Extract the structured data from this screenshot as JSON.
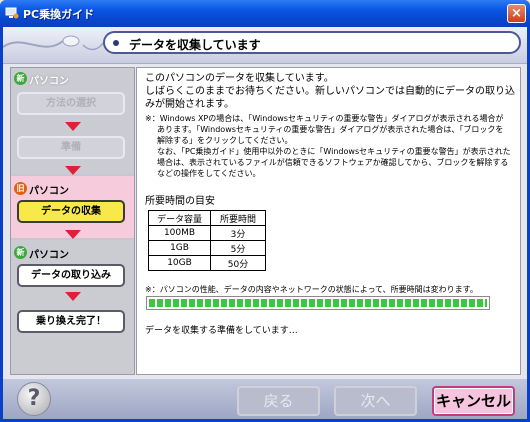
{
  "window": {
    "title": "PC乗換ガイド",
    "close_label": "×"
  },
  "header": {
    "title": "データを収集しています"
  },
  "sidebar": {
    "section_old_pc_1": {
      "badge": "新",
      "label": "パソコン"
    },
    "steps_top": [
      {
        "label": "方法の選択"
      },
      {
        "label": "準備"
      }
    ],
    "section_old_pc": {
      "badge": "旧",
      "label": "パソコン"
    },
    "step_active": {
      "label": "データの収集"
    },
    "section_new_pc": {
      "badge": "新",
      "label": "パソコン"
    },
    "steps_bottom": [
      {
        "label": "データの取り込み"
      },
      {
        "label": "乗り換え完了！"
      }
    ]
  },
  "main": {
    "intro_line1": "このパソコンのデータを収集しています。",
    "intro_line2": "しばらくこのままでお待ちください。新しいパソコンでは自動的にデータの取り込みが開始されます。",
    "note_line1": "※：Windows XPの場合は、「Windowsセキュリティの重要な警告」ダイアログが表示される場合が",
    "note_line2": "あります。「Windowsセキュリティの重要な警告」ダイアログが表示された場合は、「ブロックを",
    "note_line3": "解除する」をクリックしてください。",
    "note_line4": "なお、「PC乗換ガイド」使用中以外のときに「Windowsセキュリティの重要な警告」が表示された",
    "note_line5": "場合は、表示されているファイルが信頼できるソフトウェアか確認してから、ブロックを解除する",
    "note_line6": "などの操作をしてください。",
    "table_title": "所要時間の目安",
    "table": {
      "headers": [
        "データ容量",
        "所要時間"
      ],
      "rows": [
        [
          "100MB",
          "3分"
        ],
        [
          "1GB",
          "5分"
        ],
        [
          "10GB",
          "50分"
        ]
      ]
    },
    "caveat": "※：パソコンの性能、データの内容やネットワークの状態によって、所要時間は変わります。",
    "progress": {
      "fraction": 1.0
    },
    "status": "データを収集する準備をしています…"
  },
  "footer": {
    "help_label": "?",
    "back_label": "戻る",
    "next_label": "次へ",
    "cancel_label": "キャンセル"
  },
  "colors": {
    "titlebar": "#0a58e4",
    "active_step": "#f8e84a",
    "arrow": "#e0203a",
    "progress": "#3cc83c",
    "cancel": "#f7c4e0"
  }
}
